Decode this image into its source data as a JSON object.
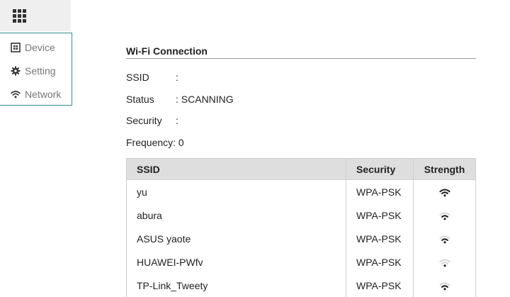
{
  "sidebar": {
    "items": [
      {
        "label": "Device",
        "icon": "device-icon"
      },
      {
        "label": "Setting",
        "icon": "gear-icon"
      },
      {
        "label": "Network",
        "icon": "wifi-icon"
      }
    ]
  },
  "connection": {
    "title": "Wi-Fi Connection",
    "ssid_label": "SSID",
    "ssid_value": ":",
    "status_label": "Status",
    "status_value": ": SCANNING",
    "security_label": "Security",
    "security_value": ":",
    "frequency_label": "Frequency",
    "frequency_value": ": 0"
  },
  "networks": {
    "columns": [
      "SSID",
      "Security",
      "Strength"
    ],
    "rows": [
      {
        "ssid": "yu",
        "security": "WPA-PSK",
        "strength": "strong"
      },
      {
        "ssid": "abura",
        "security": "WPA-PSK",
        "strength": "good"
      },
      {
        "ssid": "ASUS yaote",
        "security": "WPA-PSK",
        "strength": "good"
      },
      {
        "ssid": "HUAWEI-PWfv",
        "security": "WPA-PSK",
        "strength": "weak"
      },
      {
        "ssid": "TP-Link_Tweety",
        "security": "WPA-PSK",
        "strength": "good"
      }
    ]
  },
  "colors": {
    "accent": "#2f8f8b",
    "header_bg": "#dedede",
    "toggle_bg": "#efefef"
  }
}
